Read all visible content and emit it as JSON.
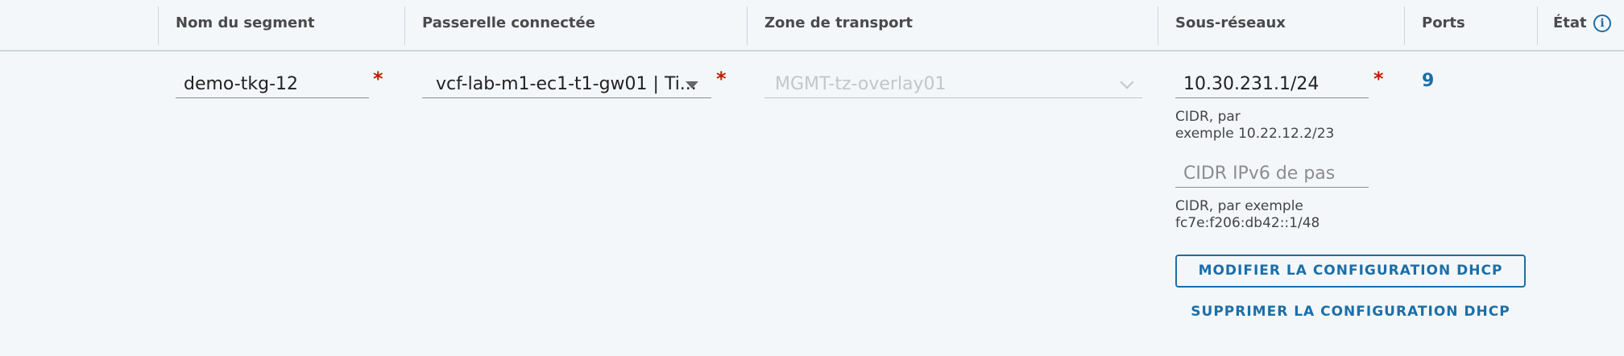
{
  "columns": {
    "segment_name": "Nom du segment",
    "connected_gateway": "Passerelle connectée",
    "transport_zone": "Zone de transport",
    "subnets": "Sous-réseaux",
    "ports": "Ports",
    "state": "État"
  },
  "row": {
    "segment_name_value": "demo-tkg-12",
    "gateway_value": "vcf-lab-m1-ec1-t1-gw01 | Ti...",
    "transport_zone_value": "MGMT-tz-overlay01",
    "subnet_ipv4_value": "10.30.231.1/24",
    "subnet_ipv4_helper_line1": "CIDR, par",
    "subnet_ipv4_helper_line2": "exemple 10.22.12.2/23",
    "subnet_ipv6_placeholder": "CIDR IPv6 de pas",
    "subnet_ipv6_helper_line1": "CIDR, par exemple",
    "subnet_ipv6_helper_line2": "fc7e:f206:db42::1/48",
    "ports_count": "9",
    "modify_dhcp_label": "MODIFIER LA CONFIGURATION DHCP",
    "delete_dhcp_label": "SUPPRIMER LA CONFIGURATION DHCP"
  },
  "required_marker": "*",
  "info_icon_glyph": "i",
  "colors": {
    "accent": "#1b6fa8",
    "required": "#c21d00",
    "background": "#f4f7fa"
  },
  "icons": [
    "info-icon",
    "dropdown-caret-icon",
    "chevron-down-icon"
  ]
}
